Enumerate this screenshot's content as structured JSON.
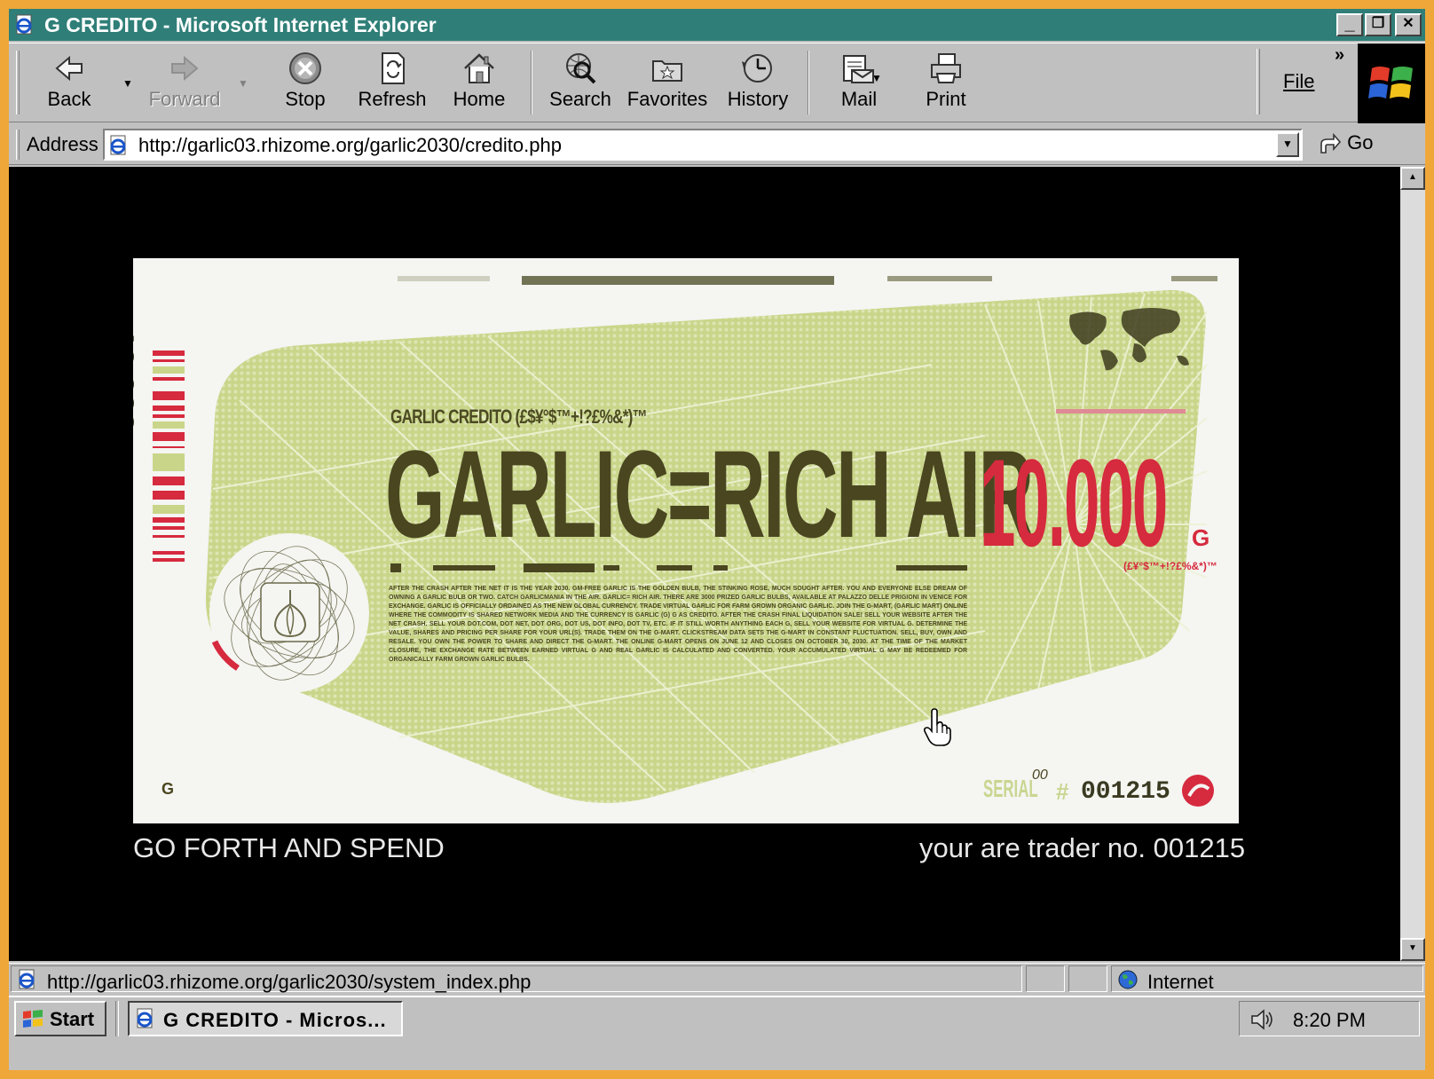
{
  "window": {
    "title": "G CREDITO - Microsoft Internet Explorer",
    "minimize_glyph": "_",
    "restore_glyph": "❐",
    "close_glyph": "✕"
  },
  "toolbar": {
    "back_label": "Back",
    "forward_label": "Forward",
    "stop_label": "Stop",
    "refresh_label": "Refresh",
    "home_label": "Home",
    "search_label": "Search",
    "favorites_label": "Favorites",
    "history_label": "History",
    "mail_label": "Mail",
    "print_label": "Print",
    "file_menu_label": "File",
    "chevron": "»",
    "forward_enabled": false
  },
  "address_bar": {
    "label": "Address",
    "url": "http://garlic03.rhizome.org/garlic2030/credito.php",
    "go_label": "Go"
  },
  "page": {
    "banknote": {
      "brand_line": "GARLIC CREDITO (£$¥°$™+!?£%&*)™",
      "headline": "GARLIC=RICH AIR",
      "amount": "10.000",
      "amount_unit": "G",
      "amount_footnote": "(£¥°$™+!?£%&*)™",
      "vertical_value": "10.000",
      "body_text": "AFTER THE CRASH AFTER THE NET IT IS THE YEAR 2030. GM-FREE GARLIC IS THE GOLDEN BULB, THE STINKING ROSE, MUCH SOUGHT AFTER. YOU AND EVERYONE ELSE DREAM OF OWNING A GARLIC BULB OR TWO. CATCH GARLICMANIA IN THE AIR. GARLIC= RICH AIR. THERE ARE 3000 PRIZED GARLIC BULBS, AVAILABLE AT PALAZZO DELLE PRIGIONI IN VENICE FOR EXCHANGE. GARLIC IS OFFICIALLY ORDAINED AS THE NEW GLOBAL CURRENCY. TRADE VIRTUAL GARLIC FOR FARM GROWN ORGANIC GARLIC. JOIN THE G-MART, (GARLIC MART) ONLINE WHERE THE COMMODITY IS SHARED NETWORK MEDIA AND THE CURRENCY IS GARLIC (G) G AS CREDITO. AFTER THE CRASH FINAL LIQUIDATION SALE! SELL YOUR WEBSITE AFTER THE NET CRASH. SELL YOUR DOT.COM, DOT NET, DOT ORG, DOT US, DOT INFO, DOT TV, ETC. IF IT STILL WORTH ANYTHING EACH G, SELL YOUR WEBSITE FOR VIRTUAL G. DETERMINE THE VALUE, SHARES AND PRICING PER SHARE FOR YOUR URL(S). TRADE THEM ON THE G-MART. CLICKSTREAM DATA SETS THE G-MART IN CONSTANT FLUCTUATION. SELL, BUY, OWN AND RESALE. YOU OWN THE POWER TO SHARE AND DIRECT THE G-MART. THE ONLINE G-MART OPENS ON JUNE 12 AND CLOSES ON OCTOBER 30, 2030. AT THE TIME OF THE MARKET CLOSURE, THE EXCHANGE RATE BETWEEN EARNED VIRTUAL G AND REAL GARLIC IS CALCULATED AND CONVERTED. YOUR ACCUMULATED VIRTUAL G MAY BE REDEEMED FOR ORGANICALLY FARM GROWN GARLIC BULBS.",
      "serial_label": "SERIAL",
      "serial_prefix": "00",
      "serial_hash": "#",
      "serial_number": "001215",
      "corner_mark": "G",
      "colors": {
        "panel_green": "#c9d68a",
        "headline_olive": "#4a4620",
        "amount_red": "#d62a3e",
        "paper": "#f5f5f2"
      }
    },
    "caption_left": "GO FORTH AND SPEND",
    "caption_right": "your are trader no. 001215"
  },
  "status_bar": {
    "url": "http://garlic03.rhizome.org/garlic2030/system_index.php",
    "zone": "Internet"
  },
  "taskbar": {
    "start_label": "Start",
    "task_label": "G CREDITO - Micros...",
    "clock": "8:20 PM"
  },
  "icons": {
    "ie_page": "ie-page-icon",
    "back": "back-arrow-icon",
    "forward": "forward-arrow-icon",
    "stop": "stop-icon",
    "refresh": "refresh-icon",
    "home": "home-icon",
    "search": "search-globe-icon",
    "favorites": "favorites-folder-icon",
    "history": "history-icon",
    "mail": "mail-icon",
    "print": "printer-icon",
    "windows": "windows-logo-icon",
    "go": "go-arrow-icon",
    "globe": "internet-globe-icon",
    "volume": "speaker-icon",
    "cursor": "hand-cursor-icon"
  }
}
